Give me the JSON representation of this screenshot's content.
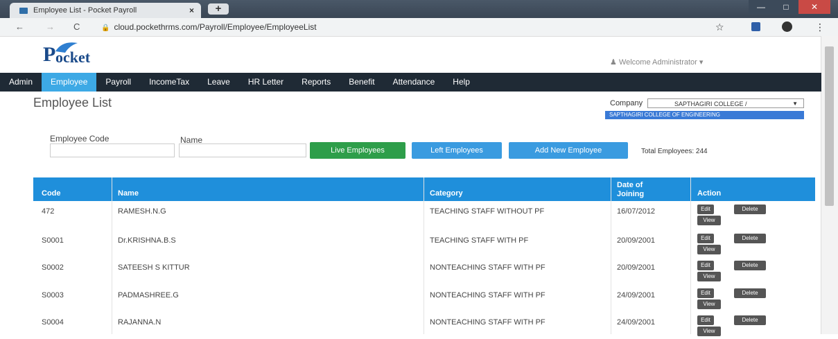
{
  "browser": {
    "tab_title": "Employee List - Pocket Payroll",
    "tab_close": "×",
    "new_tab": "+",
    "back": "←",
    "forward": "→",
    "reload": "C",
    "url": "cloud.pockethrms.com/Payroll/Employee/EmployeeList",
    "star": "☆",
    "menu": "⋮"
  },
  "header": {
    "logo_text": "Pocket",
    "welcome": "Welcome Administrator"
  },
  "menu": {
    "items": [
      "Admin",
      "Employee",
      "Payroll",
      "IncomeTax",
      "Leave",
      "HR Letter",
      "Reports",
      "Benefit",
      "Attendance",
      "Help"
    ],
    "active": "Employee"
  },
  "page": {
    "title": "Employee List",
    "company_label": "Company",
    "company_selected": "SAPTHAGIRI COLLEGE /",
    "company_option": "SAPTHAGIRI COLLEGE OF ENGINEERING"
  },
  "filters": {
    "code_label": "Employee Code",
    "name_label": "Name",
    "code_value": "",
    "name_value": ""
  },
  "buttons": {
    "live": "Live Employees",
    "left": "Left Employees",
    "add": "Add New Employee"
  },
  "total": "Total Employees: 244",
  "table": {
    "headers": {
      "code": "Code",
      "name": "Name",
      "category": "Category",
      "doj_line1": "Date of",
      "doj_line2": "Joining",
      "action": "Action"
    },
    "action_labels": {
      "edit": "Edit",
      "delete": "Delete",
      "view": "View"
    },
    "rows": [
      {
        "code": "472",
        "name": "RAMESH.N.G",
        "category": "TEACHING STAFF WITHOUT PF",
        "doj": "16/07/2012"
      },
      {
        "code": "S0001",
        "name": "Dr.KRISHNA.B.S",
        "category": "TEACHING STAFF WITH PF",
        "doj": "20/09/2001"
      },
      {
        "code": "S0002",
        "name": "SATEESH S KITTUR",
        "category": "NONTEACHING STAFF WITH PF",
        "doj": "20/09/2001"
      },
      {
        "code": "S0003",
        "name": "PADMASHREE.G",
        "category": "NONTEACHING STAFF WITH PF",
        "doj": "24/09/2001"
      },
      {
        "code": "S0004",
        "name": "RAJANNA.N",
        "category": "NONTEACHING STAFF WITH PF",
        "doj": "24/09/2001"
      }
    ]
  },
  "colors": {
    "menu_bg": "#1f2a35",
    "menu_active": "#3da9e5",
    "table_header": "#1f8fdb",
    "btn_live": "#2e9e4a",
    "btn_blue": "#3a9be0",
    "action_btn": "#555555"
  }
}
